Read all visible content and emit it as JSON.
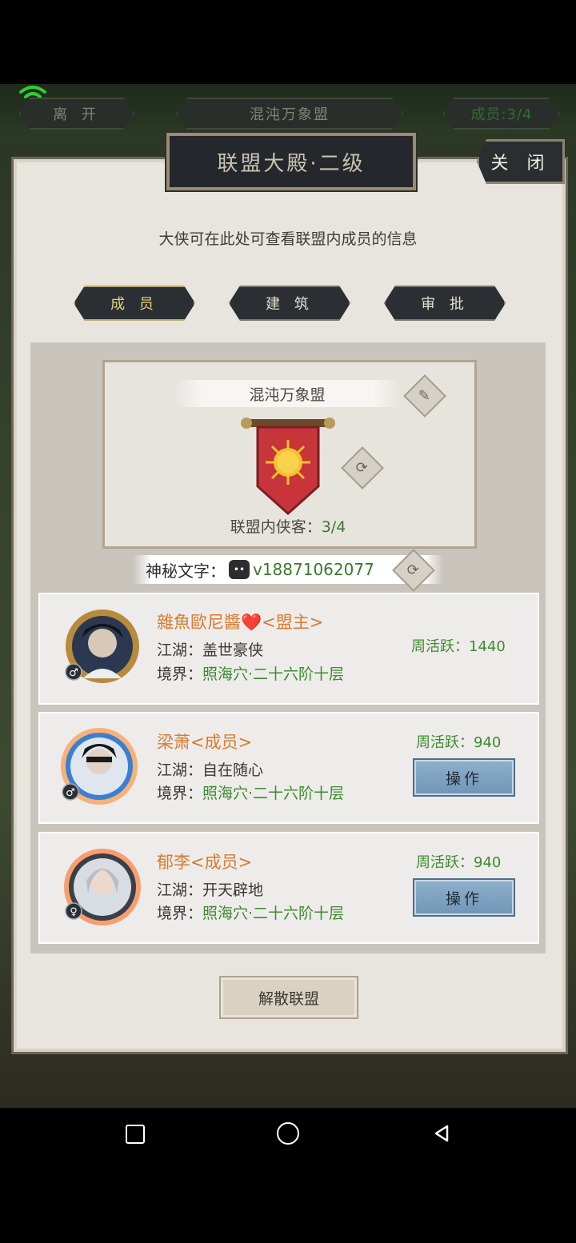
{
  "topbar": {
    "leave_label": "离 开",
    "alliance_name": "混沌万象盟",
    "members_label": "成员:3/4"
  },
  "panel": {
    "title": "联盟大殿·二级",
    "close_label": "关 闭",
    "description": "大侠可在此处可查看联盟内成员的信息"
  },
  "tabs": [
    {
      "label": "成 员",
      "active": true
    },
    {
      "label": "建 筑",
      "active": false
    },
    {
      "label": "审 批",
      "active": false
    }
  ],
  "guild": {
    "name": "混沌万象盟",
    "count_label": "联盟内侠客：",
    "count_value": "3/4"
  },
  "secret": {
    "label": "神秘文字：",
    "value": "v18871062077"
  },
  "members": [
    {
      "name": "雜魚歐尼醬❤️<盟主>",
      "jianghu": "江湖：盖世豪侠",
      "realm_label": "境界：",
      "realm": "照海穴·二十六阶十层",
      "activity": "周活跃：1440",
      "gender": "♂",
      "has_op": false
    },
    {
      "name": "梁萧<成员>",
      "jianghu": "江湖：自在随心",
      "realm_label": "境界：",
      "realm": "照海穴·二十六阶十层",
      "activity": "周活跃：940",
      "gender": "♂",
      "has_op": true,
      "op_label": "操作"
    },
    {
      "name": "郁李<成员>",
      "jianghu": "江湖：开天辟地",
      "realm_label": "境界：",
      "realm": "照海穴·二十六阶十层",
      "activity": "周活跃：940",
      "gender": "♀",
      "has_op": true,
      "op_label": "操作"
    }
  ],
  "disband_label": "解散联盟",
  "colors": {
    "accent_green": "#3f8b2f",
    "name_orange": "#d97a2e",
    "op_blue": "#7a9ec0"
  }
}
